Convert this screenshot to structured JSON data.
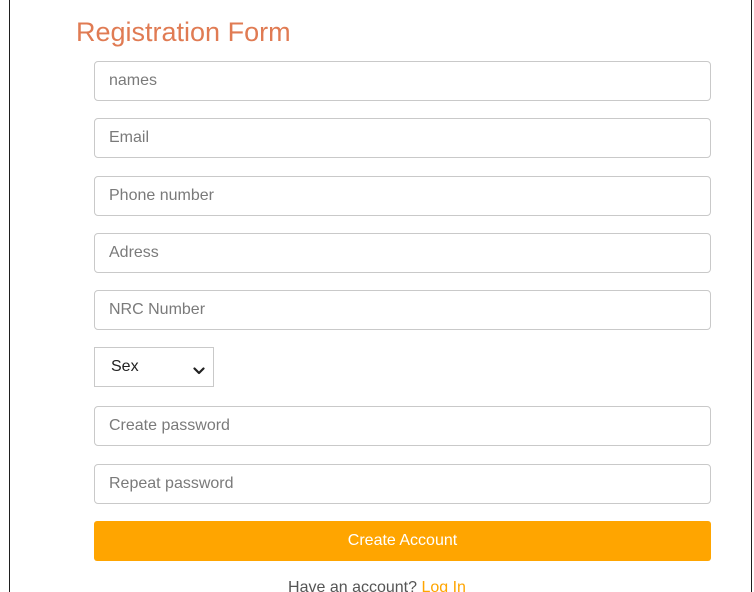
{
  "form": {
    "title": "Registration Form",
    "fields": {
      "names_placeholder": "names",
      "email_placeholder": "Email",
      "phone_placeholder": "Phone number",
      "address_placeholder": "Adress",
      "nrc_placeholder": "NRC Number",
      "password_placeholder": "Create password",
      "repeat_password_placeholder": "Repeat password"
    },
    "sex_select": {
      "selected": "Sex",
      "chevron_icon": "chevron-down-icon"
    },
    "submit_label": "Create Account",
    "footer": {
      "prompt": "Have an account?",
      "login_label": "Log In"
    }
  },
  "colors": {
    "title": "#e07b53",
    "accent": "#ffa500",
    "border": "#c9c9c9",
    "placeholder": "#7a7a7a"
  }
}
